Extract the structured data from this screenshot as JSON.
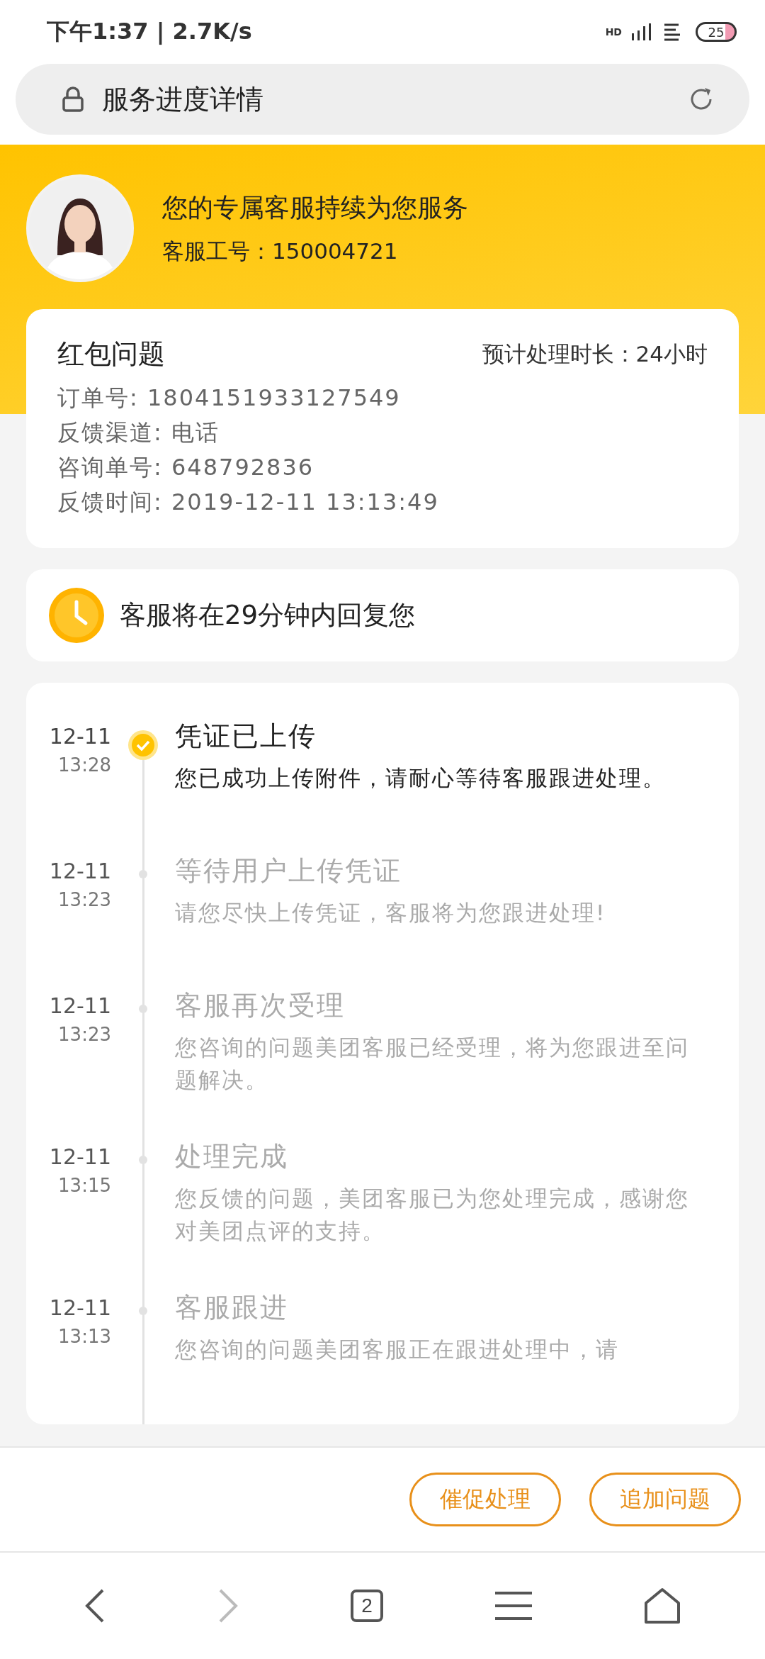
{
  "status_bar": {
    "time": "下午1:37 | 2.7K/s",
    "signal_label": "HD",
    "battery": "25"
  },
  "address_bar": {
    "title": "服务进度详情"
  },
  "agent": {
    "title": "您的专属客服持续为您服务",
    "id_line": "客服工号：150004721"
  },
  "issue": {
    "title": "红包问题",
    "estimate": "预计处理时长：24小时",
    "details": [
      "订单号: 1804151933127549",
      "反馈渠道: 电话",
      "咨询单号: 648792836",
      "反馈时间: 2019-12-11 13:13:49"
    ]
  },
  "reply_notice": "客服将在29分钟内回复您",
  "timeline": [
    {
      "date": "12-11",
      "time": "13:28",
      "title": "凭证已上传",
      "description": "您已成功上传附件，请耐心等待客服跟进处理。",
      "active": true
    },
    {
      "date": "12-11",
      "time": "13:23",
      "title": "等待用户上传凭证",
      "description": "请您尽快上传凭证，客服将为您跟进处理!",
      "active": false
    },
    {
      "date": "12-11",
      "time": "13:23",
      "title": "客服再次受理",
      "description": "您咨询的问题美团客服已经受理，将为您跟进至问题解决。",
      "active": false
    },
    {
      "date": "12-11",
      "time": "13:15",
      "title": "处理完成",
      "description": "您反馈的问题，美团客服已为您处理完成，感谢您对美团点评的支持。",
      "active": false
    },
    {
      "date": "12-11",
      "time": "13:13",
      "title": "客服跟进",
      "description": "您咨询的问题美团客服正在跟进处理中，请",
      "active": false
    }
  ],
  "actions": [
    "催促处理",
    "追加问题"
  ],
  "nav": {
    "tabs_count": "2"
  }
}
